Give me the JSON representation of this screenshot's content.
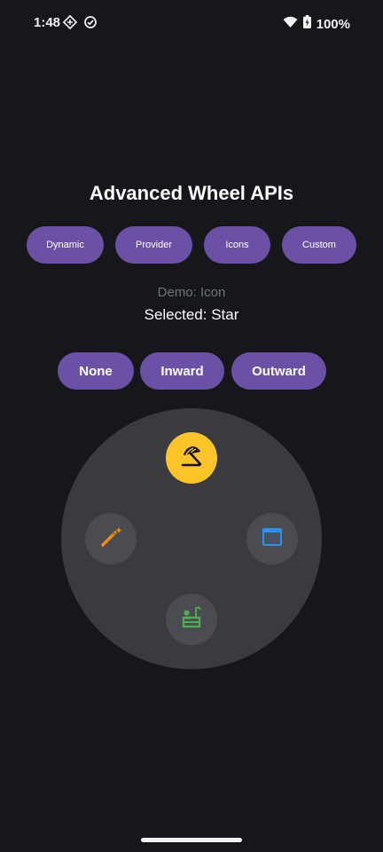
{
  "status_bar": {
    "time": "1:48",
    "battery": "100%"
  },
  "title": "Advanced Wheel APIs",
  "demo_buttons": [
    "Dynamic",
    "Provider",
    "Icons",
    "Custom"
  ],
  "demo_label": "Demo: Icon",
  "selected_label": "Selected: Star",
  "direction_buttons": [
    "None",
    "Inward",
    "Outward"
  ],
  "wheel": {
    "items": [
      {
        "icon": "beach-umbrella-icon",
        "position": "top",
        "selected": true,
        "color": "#000000"
      },
      {
        "icon": "web-browser-icon",
        "position": "right",
        "selected": false,
        "color": "#2f8ff0"
      },
      {
        "icon": "bathtub-icon",
        "position": "bottom",
        "selected": false,
        "color": "#4caf50"
      },
      {
        "icon": "magic-wand-icon",
        "position": "left",
        "selected": false,
        "color": "#f28f12"
      }
    ]
  },
  "colors": {
    "background": "#15171b",
    "button": "#6a51a6",
    "wheel": "#393b40",
    "wheel_item": "#4a4c51",
    "selected_item": "#fbc428",
    "muted_text": "#6f737a"
  }
}
